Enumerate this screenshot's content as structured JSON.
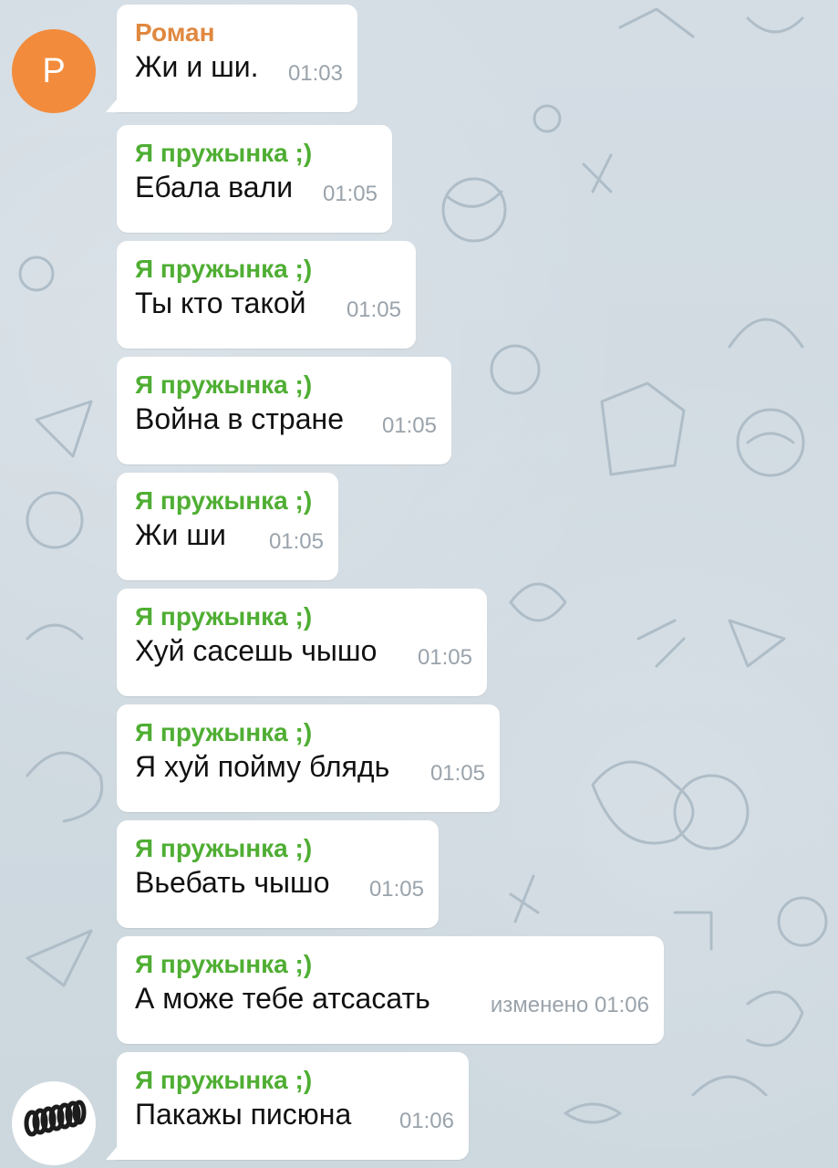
{
  "chat": {
    "avatars": {
      "roman_letter": "Р"
    },
    "messages": [
      {
        "sender": "Роман",
        "text": "Жи и ши.",
        "time": "01:03"
      },
      {
        "sender": "Я пружынка ;)",
        "text": "Ебала вали",
        "time": "01:05"
      },
      {
        "sender": "Я пружынка ;)",
        "text": "Ты кто такой",
        "time": "01:05"
      },
      {
        "sender": "Я пружынка ;)",
        "text": "Война в стране",
        "time": "01:05"
      },
      {
        "sender": "Я пружынка ;)",
        "text": "Жи ши",
        "time": "01:05"
      },
      {
        "sender": "Я пружынка ;)",
        "text": "Хуй сасешь чышо",
        "time": "01:05"
      },
      {
        "sender": "Я пружынка ;)",
        "text": "Я хуй пойму блядь",
        "time": "01:05"
      },
      {
        "sender": "Я пружынка ;)",
        "text": "Вьебать чышо",
        "time": "01:05"
      },
      {
        "sender": "Я пружынка ;)",
        "text": "А може тебе атсасать",
        "time": "изменено 01:06"
      },
      {
        "sender": "Я пружынка ;)",
        "text": "Пакажы писюна",
        "time": "01:06"
      }
    ]
  },
  "colors": {
    "roman_name": "#e08840",
    "pruzhynka_name": "#4fae33",
    "roman_avatar": "#f28b3c",
    "bubble": "#ffffff",
    "background": "#cfd9e0"
  }
}
